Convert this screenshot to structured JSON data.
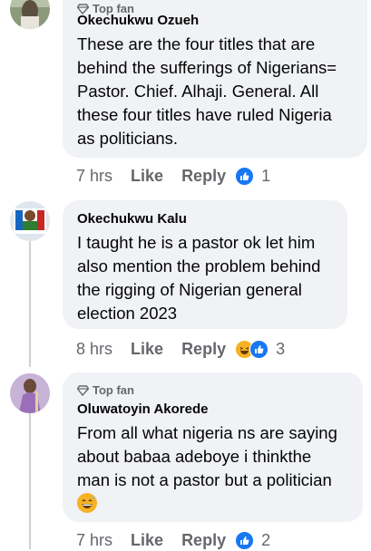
{
  "comments": [
    {
      "badge": "Top fan",
      "author": "Okechukwu Ozueh",
      "lines": [
        "These are the four titles that are",
        "behind the sufferings of Nigerians=",
        "Pastor. Chief. Alhaji. General. All",
        "these  four titles have ruled Nigeria",
        "as politicians."
      ],
      "time": "7 hrs",
      "like_label": "Like",
      "reply_label": "Reply",
      "reaction_icons": [
        "like-reaction-icon"
      ],
      "reaction_count": "1"
    },
    {
      "author": "Okechukwu Kalu",
      "lines": [
        "I taught he is a pastor ok let him",
        "also mention the problem behind",
        "the rigging of Nigerian general",
        "election 2023"
      ],
      "time": "8 hrs",
      "like_label": "Like",
      "reply_label": "Reply",
      "reaction_icons": [
        "haha-reaction-icon",
        "like-reaction-icon"
      ],
      "reaction_count": "3"
    },
    {
      "badge": "Top fan",
      "author": "Oluwatoyin Akorede",
      "lines": [
        "From all what nigeria ns are saying",
        "about babaa adeboye i thinkthe",
        "man is not a pastor but a politician"
      ],
      "emoji": "grinning-sweat-emoji",
      "time": "7 hrs",
      "like_label": "Like",
      "reply_label": "Reply",
      "reaction_icons": [
        "like-reaction-icon"
      ],
      "reaction_count": "2"
    }
  ],
  "colors": {
    "bubble": "#f0f2f5",
    "meta_text": "#65676b",
    "like_blue": "#1877f2",
    "haha_yellow": "#f7b125"
  }
}
